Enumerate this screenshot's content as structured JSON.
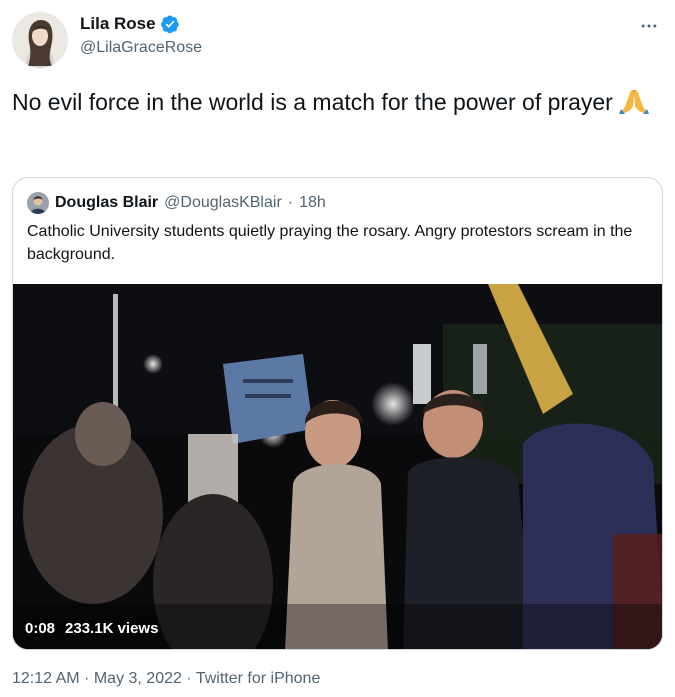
{
  "author": {
    "name": "Lila Rose",
    "handle": "@LilaGraceRose",
    "verified": true,
    "more_icon": "more-horizontal-icon"
  },
  "tweet": {
    "text": "No evil force in the world is a match for the power of prayer",
    "emoji": "folded-hands-emoji"
  },
  "quote": {
    "author_name": "Douglas Blair",
    "author_handle": "@DouglasKBlair",
    "separator": "·",
    "age": "18h",
    "text": "Catholic University students quietly praying the rosary. Angry protestors scream in the background.",
    "video": {
      "duration": "0:08",
      "views": "233.1K views"
    }
  },
  "footer": {
    "time": "12:12 AM",
    "date": "May 3, 2022",
    "source": "Twitter for iPhone",
    "separator": "·"
  },
  "colors": {
    "text_primary": "#0f1419",
    "text_secondary": "#536471",
    "border": "#cfd9de",
    "verified_blue": "#1d9bf0"
  }
}
